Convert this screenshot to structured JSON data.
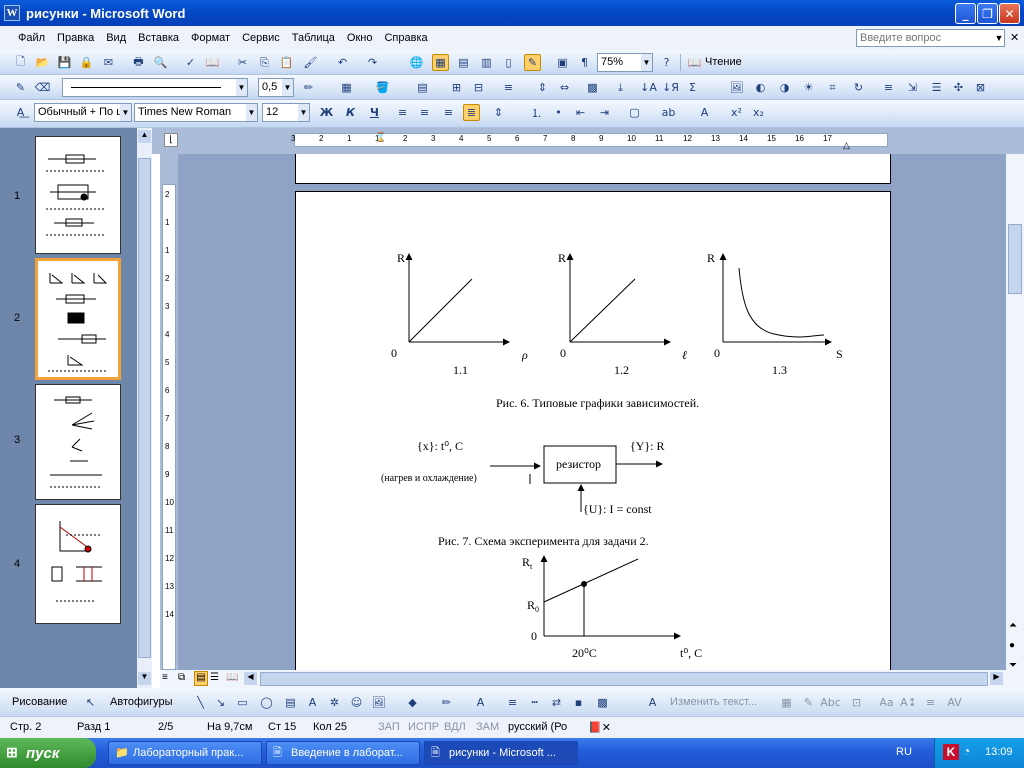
{
  "window": {
    "title": "рисунки - Microsoft Word",
    "app_icon": "W"
  },
  "menu": {
    "items": [
      "Файл",
      "Правка",
      "Вид",
      "Вставка",
      "Формат",
      "Сервис",
      "Таблица",
      "Окно",
      "Справка"
    ],
    "ask_placeholder": "Введите вопрос"
  },
  "toolbar1": {
    "zoom": "75%",
    "reading_label": "Чтение"
  },
  "toolbar2": {
    "line_weight": "0,5"
  },
  "toolbar3": {
    "style": "Обычный + По ц",
    "font": "Times New Roman",
    "size": "12",
    "bold": "Ж",
    "italic": "К",
    "underline": "Ч"
  },
  "thumbnails": {
    "numbers": [
      "1",
      "2",
      "3",
      "4"
    ],
    "selected": "2"
  },
  "ruler": {
    "h_labels": [
      "3",
      "2",
      "1",
      "1",
      "2",
      "3",
      "4",
      "5",
      "6",
      "7",
      "8",
      "9",
      "10",
      "11",
      "12",
      "13",
      "14",
      "15",
      "16",
      "17"
    ],
    "v_labels": [
      "2",
      "1",
      "1",
      "2",
      "3",
      "4",
      "5",
      "6",
      "7",
      "8",
      "9",
      "10",
      "11",
      "12",
      "13",
      "14"
    ]
  },
  "document": {
    "graphs": [
      {
        "y": "R",
        "origin": "0",
        "x": "ρ",
        "caption": "1.1"
      },
      {
        "y": "R",
        "origin": "0",
        "x": "ℓ",
        "caption": "1.2"
      },
      {
        "y": "R",
        "origin": "0",
        "x": "S",
        "caption": "1.3"
      }
    ],
    "fig6_caption": "Рис. 6. Типовые графики зависимостей.",
    "scheme": {
      "input": "{x}: t⁰, C",
      "input_note": "(нагрев и охлаждение)",
      "box": "резистор",
      "output": "{Y}: R",
      "control": "{U}: I = const"
    },
    "fig7_caption": "Рис. 7. Схема эксперимента для задачи 2.",
    "graph4": {
      "y": "R",
      "y_sub": "t",
      "r0": "R",
      "r0_sub": "0",
      "origin": "0",
      "point": "20⁰C",
      "x": "t⁰, C"
    }
  },
  "drawbar": {
    "draw_label": "Рисование",
    "autoshapes_label": "Автофигуры",
    "edit_text": "Изменить текст..."
  },
  "status": {
    "page": "Стр. 2",
    "section": "Разд 1",
    "pages": "2/5",
    "at": "На 9,7см",
    "line": "Ст 15",
    "col": "Кол 25",
    "rec": "ЗАП",
    "trk": "ИСПР",
    "ext": "ВДЛ",
    "ovr": "ЗАМ",
    "lang": "русский (Ро"
  },
  "taskbar": {
    "start": "пуск",
    "tasks": [
      "Лабораторный прак...",
      "Введение в лаборат...",
      "рисунки - Microsoft ..."
    ],
    "lang": "RU",
    "clock": "13:09"
  },
  "colors": {
    "title_bar": "#0a5bd8",
    "menu_bg": "#eef3fb",
    "toolbar_bg": "#dbe7f8",
    "doc_bg": "#8fa3c6",
    "thumb_pane": "#6f86ab",
    "thumb_selected": "#f3a23a",
    "taskbar": "#245edb",
    "start": "#3c9a37"
  }
}
